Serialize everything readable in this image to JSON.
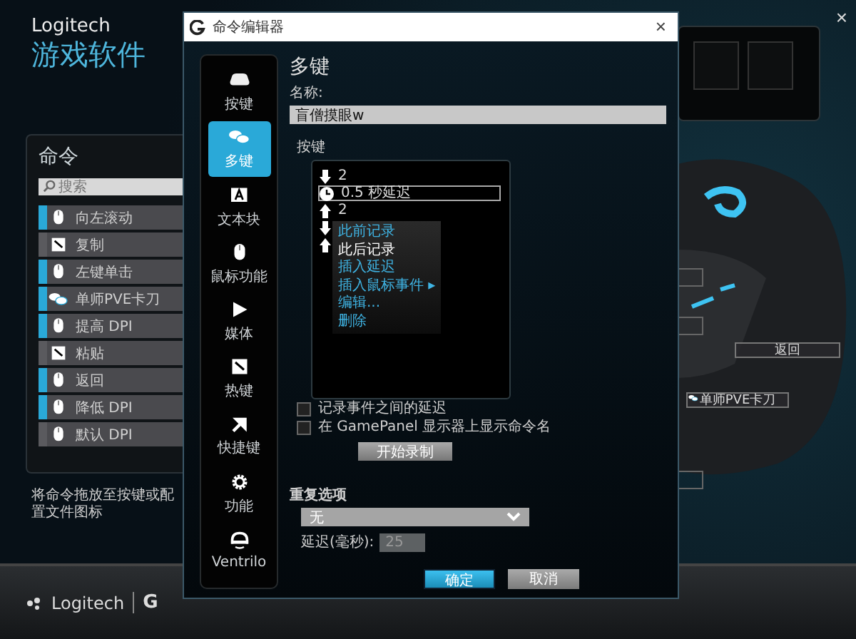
{
  "app": {
    "brand": "Logitech",
    "title": "游戏软件",
    "footer_logo": "Logitech",
    "footer_logo_mark": "G"
  },
  "commands": {
    "title": "命令",
    "search_placeholder": "搜索",
    "hint": "将命令拖放至按键或配置文件图标",
    "items": [
      {
        "label": "向左滚动",
        "kind": "mouse",
        "assigned": true
      },
      {
        "label": "复制",
        "kind": "hotkey",
        "assigned": false
      },
      {
        "label": "左键单击",
        "kind": "mouse",
        "assigned": true
      },
      {
        "label": "单师PVE卡刀",
        "kind": "multikey",
        "assigned": true
      },
      {
        "label": "提高 DPI",
        "kind": "mouse",
        "assigned": true
      },
      {
        "label": "粘贴",
        "kind": "hotkey",
        "assigned": false
      },
      {
        "label": "返回",
        "kind": "mouse",
        "assigned": true
      },
      {
        "label": "降低 DPI",
        "kind": "mouse",
        "assigned": true
      },
      {
        "label": "默认 DPI",
        "kind": "mouse",
        "assigned": false
      }
    ]
  },
  "mouse_labels": [
    {
      "text": "返回",
      "kind": "plain"
    },
    {
      "text": "单师PVE卡刀",
      "kind": "multikey"
    }
  ],
  "editor": {
    "title": "命令编辑器",
    "close": "×",
    "nav": [
      {
        "label": "按键",
        "selected": false
      },
      {
        "label": "多键",
        "selected": true
      },
      {
        "label": "文本块",
        "selected": false
      },
      {
        "label": "鼠标功能",
        "selected": false
      },
      {
        "label": "媒体",
        "selected": false
      },
      {
        "label": "热键",
        "selected": false
      },
      {
        "label": "快捷键",
        "selected": false
      },
      {
        "label": "功能",
        "selected": false
      },
      {
        "label": "Ventrilo",
        "selected": false
      }
    ],
    "heading": "多键",
    "name_label": "名称:",
    "name_value": "盲僧摸眼w",
    "keys_label": "按键",
    "keystrokes": [
      {
        "kind": "down",
        "text": "2",
        "selected": false
      },
      {
        "kind": "delay",
        "text": "0.5 秒延迟",
        "selected": true
      },
      {
        "kind": "up",
        "text": "2",
        "selected": false
      },
      {
        "kind": "down",
        "selected": false
      },
      {
        "kind": "up",
        "selected": false
      }
    ],
    "context_menu": [
      {
        "label": "此前记录",
        "selected": false
      },
      {
        "label": "此后记录",
        "selected": true
      },
      {
        "label": "插入延迟",
        "selected": false
      },
      {
        "label": "插入鼠标事件",
        "selected": false,
        "submenu_arrow": "▸"
      },
      {
        "label": "编辑...",
        "selected": false
      },
      {
        "label": "删除",
        "selected": false
      }
    ],
    "checkboxes": [
      {
        "label": "记录事件之间的延迟",
        "checked": false
      },
      {
        "label": "在 GamePanel 显示器上显示命令名",
        "checked": false
      }
    ],
    "record_button": "开始录制",
    "repeat_label": "重复选项",
    "repeat_value": "无",
    "delay_label": "延迟(毫秒):",
    "delay_value": "25",
    "delay_disabled": true,
    "ok": "确定",
    "cancel": "取消"
  }
}
